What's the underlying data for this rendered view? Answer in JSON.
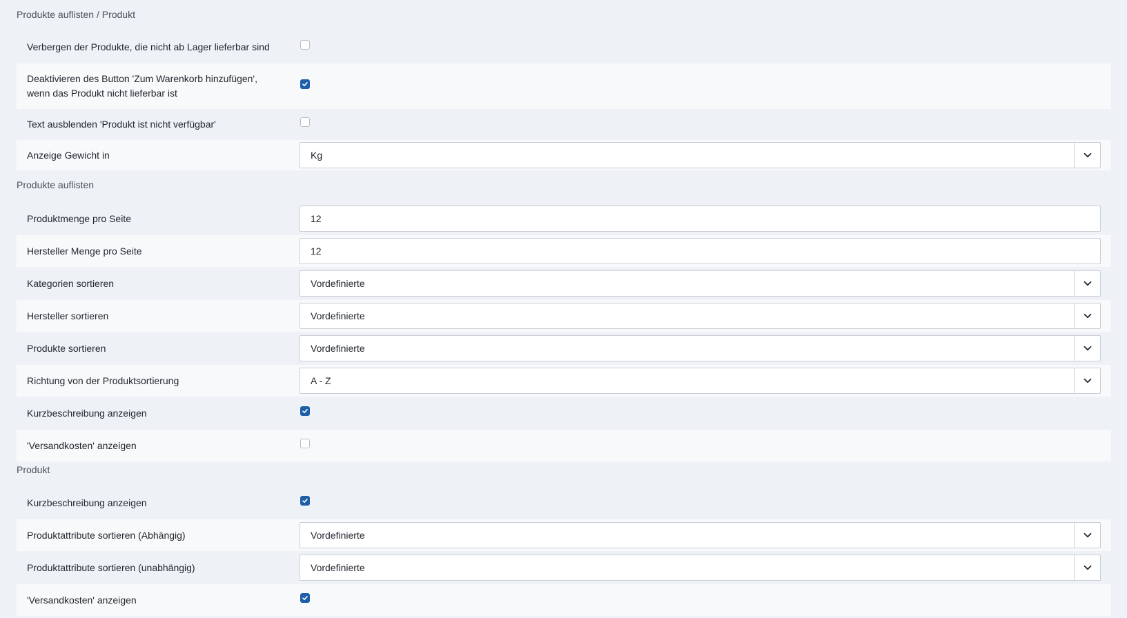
{
  "sections": {
    "s1": "Produkte auflisten / Produkt",
    "s2": "Produkte auflisten",
    "s3": "Produkt"
  },
  "rows": {
    "r1": {
      "label": "Verbergen der Produkte, die nicht ab Lager lieferbar sind",
      "checked": false
    },
    "r2": {
      "label": "Deaktivieren des Button 'Zum Warenkorb hinzufügen', wenn das Produkt nicht lieferbar ist",
      "checked": true
    },
    "r3": {
      "label": "Text ausblenden 'Produkt ist nicht verfügbar'",
      "checked": false
    },
    "r4": {
      "label": "Anzeige Gewicht in",
      "value": "Kg"
    },
    "r5": {
      "label": "Produktmenge pro Seite",
      "value": "12"
    },
    "r6": {
      "label": "Hersteller Menge pro Seite",
      "value": "12"
    },
    "r7": {
      "label": "Kategorien sortieren",
      "value": "Vordefinierte"
    },
    "r8": {
      "label": "Hersteller sortieren",
      "value": "Vordefinierte"
    },
    "r9": {
      "label": "Produkte sortieren",
      "value": "Vordefinierte"
    },
    "r10": {
      "label": "Richtung von der Produktsortierung",
      "value": "A - Z"
    },
    "r11": {
      "label": "Kurzbeschreibung anzeigen",
      "checked": true
    },
    "r12": {
      "label": "'Versandkosten' anzeigen",
      "checked": false
    },
    "r13": {
      "label": "Kurzbeschreibung anzeigen",
      "checked": true
    },
    "r14": {
      "label": "Produktattribute sortieren (Abhängig)",
      "value": "Vordefinierte"
    },
    "r15": {
      "label": "Produktattribute sortieren (unabhängig)",
      "value": "Vordefinierte"
    },
    "r16": {
      "label": "'Versandkosten' anzeigen",
      "checked": true
    }
  },
  "icons": {
    "checkbox_check": "check-icon",
    "select_arrow": "chevron-down-icon"
  },
  "colors": {
    "accent": "#1f5ea8",
    "background": "#eef2f7",
    "row_light": "#f8f9fb"
  }
}
